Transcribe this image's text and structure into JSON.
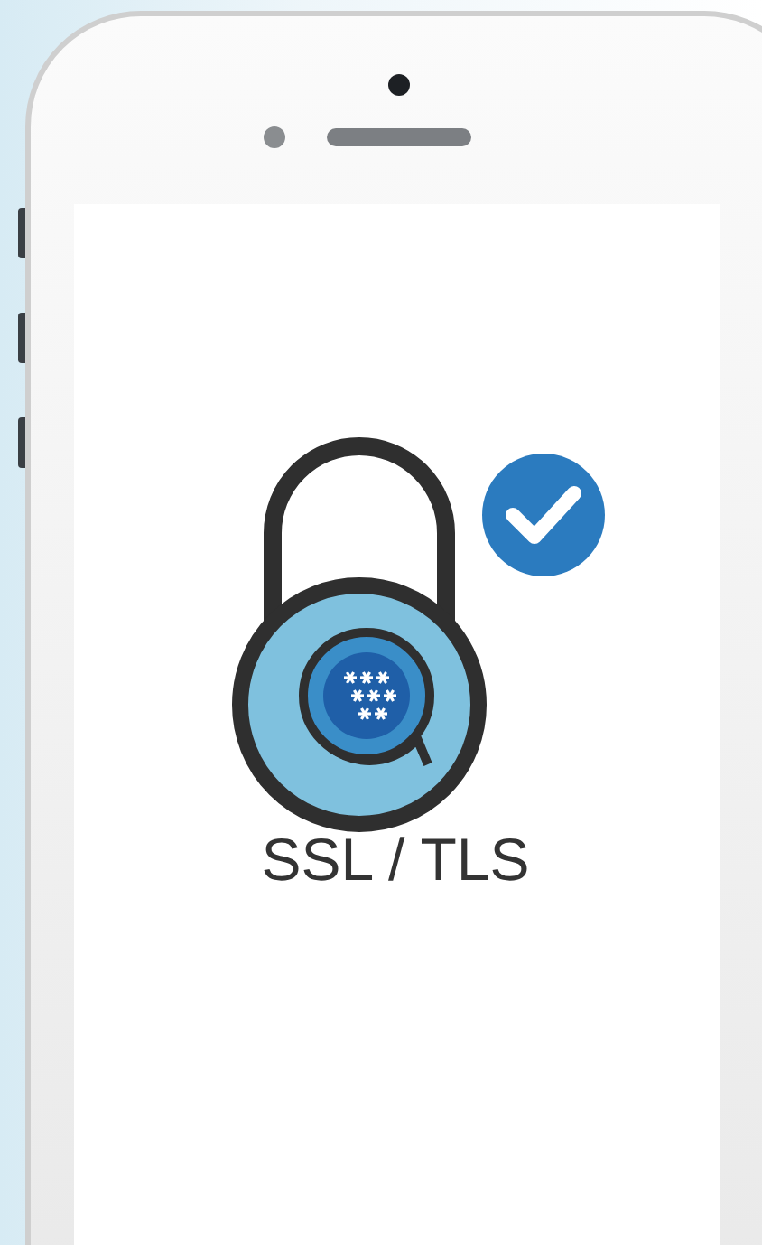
{
  "screen": {
    "caption": "SSL / TLS"
  }
}
